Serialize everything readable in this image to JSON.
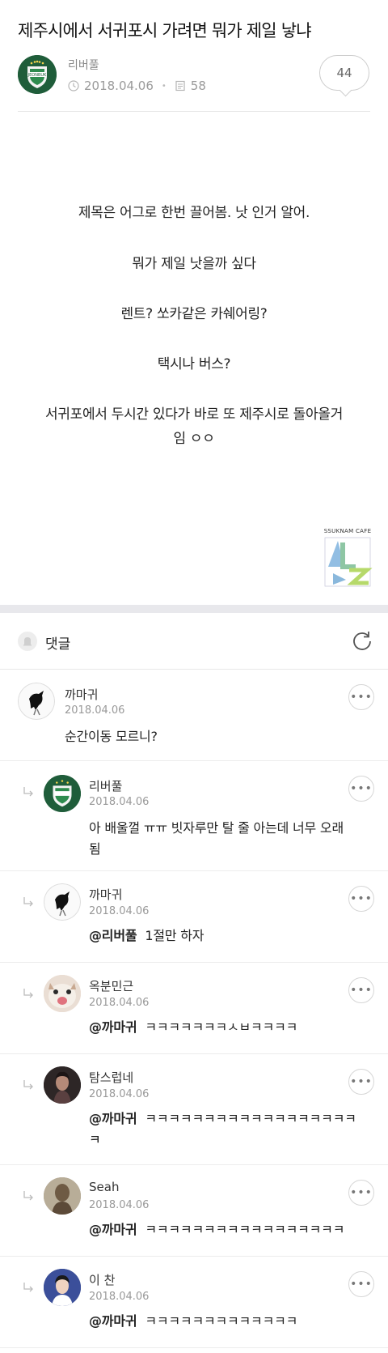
{
  "post": {
    "title": "제주시에서 서귀포시 가려면 뭐가 제일 낳냐",
    "author": "리버풀",
    "date": "2018.04.06",
    "views": "58",
    "comment_count": "44",
    "body": [
      "제목은 어그로 한번 끌어봄. 낫 인거 알어.",
      "뭐가 제일 낫을까 싶다",
      "렌트? 쏘카같은 카쉐어링?",
      "택시나 버스?",
      "서귀포에서 두시간 있다가 바로 또 제주시로 돌아올거",
      "임 ㅇㅇ"
    ]
  },
  "watermark": {
    "text": "SSUKNAM CAFE"
  },
  "comments_header": {
    "label": "댓글"
  },
  "comments": [
    {
      "name": "까마귀",
      "date": "2018.04.06",
      "mention": "",
      "text": "순간이동 모르니?",
      "reply": false
    },
    {
      "name": "리버풀",
      "date": "2018.04.06",
      "mention": "",
      "text": "아 배울껄 ㅠㅠ 빗자루만 탈 줄 아는데 너무 오래",
      "text2": "됨",
      "reply": true
    },
    {
      "name": "까마귀",
      "date": "2018.04.06",
      "mention": "@리버풀",
      "text": "1절만 하자",
      "reply": true
    },
    {
      "name": "옥분민근",
      "date": "2018.04.06",
      "mention": "@까마귀",
      "text": "ㅋㅋㅋㅋㅋㅋㅋㅅㅂㅋㅋㅋㅋ",
      "reply": true
    },
    {
      "name": "탐스럽네",
      "date": "2018.04.06",
      "mention": "@까마귀",
      "text": "ㅋㅋㅋㅋㅋㅋㅋㅋㅋㅋㅋㅋㅋㅋㅋㅋㅋㅋㅋ",
      "text2": "ㅋ",
      "reply": true
    },
    {
      "name": "Seah",
      "date": "2018.04.06",
      "mention": "@까마귀",
      "text": "ㅋㅋㅋㅋㅋㅋㅋㅋㅋㅋㅋㅋㅋㅋㅋㅋㅋ",
      "reply": true
    },
    {
      "name": "이 찬",
      "date": "2018.04.06",
      "mention": "@까마귀",
      "text": "ㅋㅋㅋㅋㅋㅋㅋㅋㅋㅋㅋㅋㅋ",
      "reply": true
    }
  ],
  "icons": {
    "clock": "clock-icon",
    "views": "document-icon",
    "bell": "bell-icon",
    "refresh": "refresh-icon",
    "more": "more-icon",
    "reply": "reply-arrow-icon"
  },
  "colors": {
    "accent_green": "#1f5d3a",
    "meta_gray": "#9a9a9a"
  }
}
